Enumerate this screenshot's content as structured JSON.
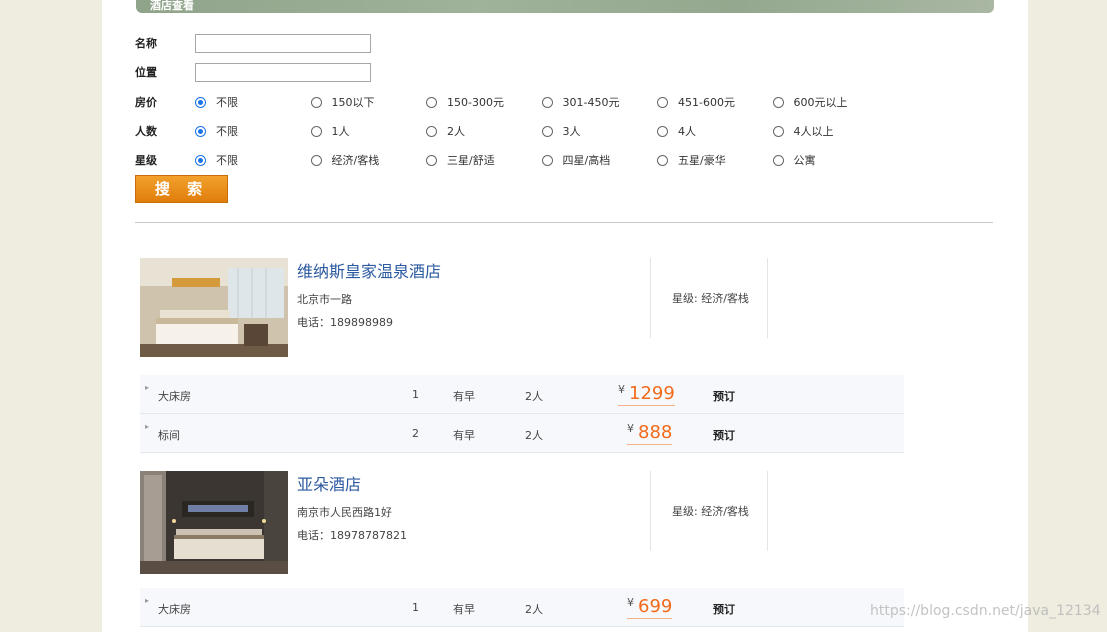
{
  "banner": {
    "title": "酒店查看"
  },
  "form": {
    "name_label": "名称",
    "location_label": "位置",
    "name_value": "",
    "location_value": "",
    "price": {
      "label": "房价",
      "options": [
        "不限",
        "150以下",
        "150-300元",
        "301-450元",
        "451-600元",
        "600元以上"
      ],
      "selected": "不限"
    },
    "people": {
      "label": "人数",
      "options": [
        "不限",
        "1人",
        "2人",
        "3人",
        "4人",
        "4人以上"
      ],
      "selected": "不限"
    },
    "stars": {
      "label": "星级",
      "options": [
        "不限",
        "经济/客栈",
        "三星/舒适",
        "四星/高档",
        "五星/豪华",
        "公寓"
      ],
      "selected": "不限"
    },
    "search_label": "搜 索"
  },
  "hotels": [
    {
      "name": "维纳斯皇家温泉酒店",
      "address": "北京市一路",
      "phone": "电话：189898989",
      "star": "星级: 经济/客栈",
      "rooms": [
        {
          "name": "大床房",
          "count": "1",
          "breakfast": "有早",
          "people": "2人",
          "currency": "¥",
          "price": "1299",
          "book": "预订"
        },
        {
          "name": "标间",
          "count": "2",
          "breakfast": "有早",
          "people": "2人",
          "currency": "¥",
          "price": "888",
          "book": "预订"
        }
      ]
    },
    {
      "name": "亚朵酒店",
      "address": "南京市人民西路1好",
      "phone": "电话：18978787821",
      "star": "星级: 经济/客栈",
      "rooms": [
        {
          "name": "大床房",
          "count": "1",
          "breakfast": "有早",
          "people": "2人",
          "currency": "¥",
          "price": "699",
          "book": "预订"
        }
      ]
    }
  ],
  "watermark": "https://blog.csdn.net/java_12134"
}
